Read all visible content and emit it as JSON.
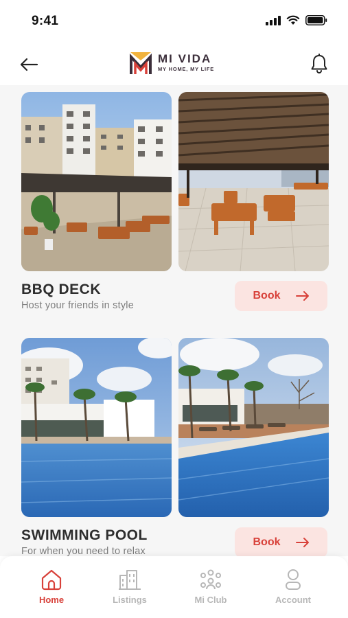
{
  "status_bar": {
    "time": "9:41"
  },
  "header": {
    "logo_name": "MI VIDA",
    "logo_tagline": "MY HOME, MY LIFE",
    "back_icon": "arrow-left-icon",
    "notification_icon": "bell-icon"
  },
  "amenities": [
    {
      "title": "BBQ DECK",
      "subtitle": "Host your friends in style",
      "book_label": "Book"
    },
    {
      "title": "SWIMMING POOL",
      "subtitle": "For when you need to relax",
      "book_label": "Book"
    }
  ],
  "tabs": [
    {
      "label": "Home",
      "icon": "home-icon",
      "active": true
    },
    {
      "label": "Listings",
      "icon": "buildings-icon",
      "active": false
    },
    {
      "label": "Mi Club",
      "icon": "community-icon",
      "active": false
    },
    {
      "label": "Account",
      "icon": "user-icon",
      "active": false
    }
  ],
  "colors": {
    "accent": "#d8413a",
    "book_bg": "#fbe4e1",
    "logo_yellow": "#f2b33d",
    "logo_red": "#d8413a",
    "logo_dark": "#3b2e3a"
  }
}
